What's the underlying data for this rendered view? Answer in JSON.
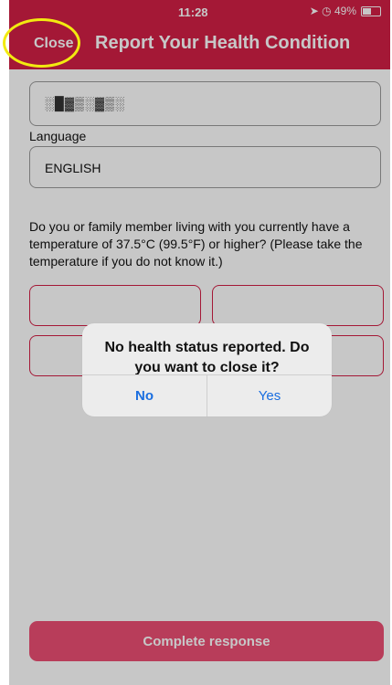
{
  "status_bar": {
    "time": "11:28",
    "right": "➤ ◷ 49%"
  },
  "header": {
    "close_label": "Close",
    "title": "Report Your Health Condition"
  },
  "form": {
    "id_value": "░█▓▒░▓▒░",
    "language_label": "Language",
    "language_value": "ENGLISH",
    "question": "Do you or family member living with you currently have a temperature of 37.5°C (99.5°F) or higher? (Please take the temperature if you do not know it.)",
    "complete_label": "Complete response"
  },
  "alert": {
    "message_line1": "No health status reported. Do",
    "message_line2": "you want to close it?",
    "no_label": "No",
    "yes_label": "Yes"
  },
  "colors": {
    "accent": "#d21f46",
    "highlight": "#f2ea10",
    "alert_button": "#1a6ee0"
  }
}
